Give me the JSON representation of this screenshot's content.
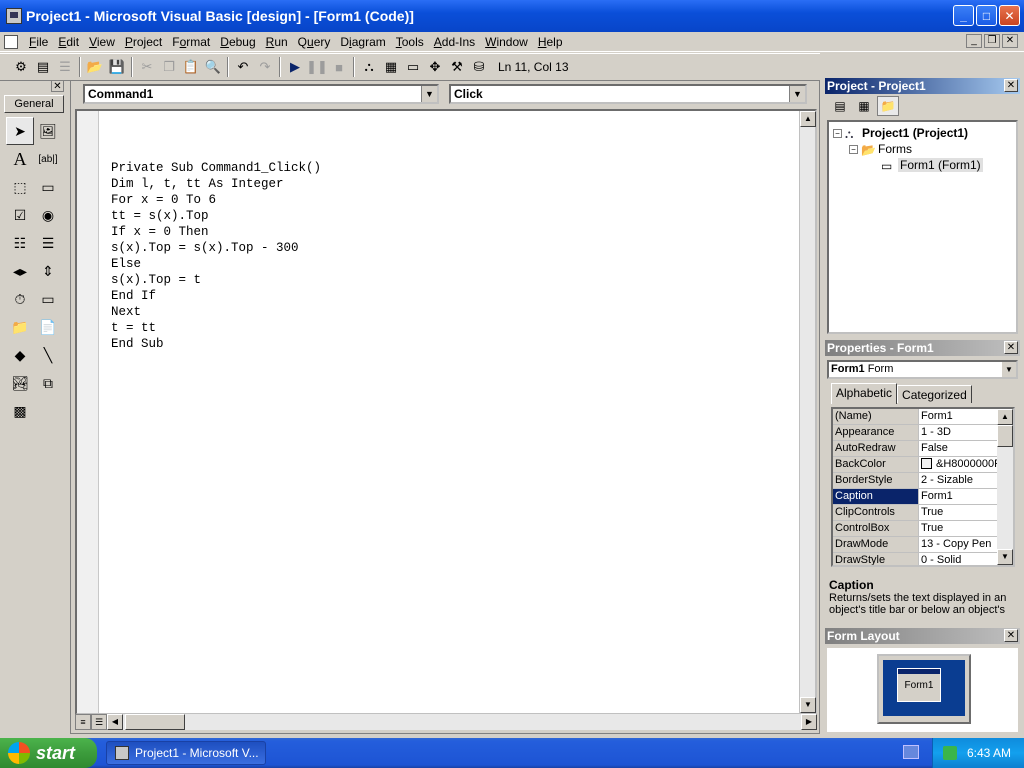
{
  "window": {
    "title": "Project1 - Microsoft Visual Basic [design] - [Form1 (Code)]"
  },
  "menu": [
    {
      "pre": "",
      "key": "F",
      "post": "ile"
    },
    {
      "pre": "",
      "key": "E",
      "post": "dit"
    },
    {
      "pre": "",
      "key": "V",
      "post": "iew"
    },
    {
      "pre": "",
      "key": "P",
      "post": "roject"
    },
    {
      "pre": "F",
      "key": "o",
      "post": "rmat"
    },
    {
      "pre": "",
      "key": "D",
      "post": "ebug"
    },
    {
      "pre": "",
      "key": "R",
      "post": "un"
    },
    {
      "pre": "Q",
      "key": "u",
      "post": "ery"
    },
    {
      "pre": "D",
      "key": "i",
      "post": "agram"
    },
    {
      "pre": "",
      "key": "T",
      "post": "ools"
    },
    {
      "pre": "",
      "key": "A",
      "post": "dd-Ins"
    },
    {
      "pre": "",
      "key": "W",
      "post": "indow"
    },
    {
      "pre": "",
      "key": "H",
      "post": "elp"
    }
  ],
  "toolbar": {
    "position": "Ln 11, Col 13"
  },
  "toolbox": {
    "tab": "General"
  },
  "code": {
    "object": "Command1",
    "procedure": "Click",
    "lines": [
      "Private Sub Command1_Click()",
      "Dim l, t, tt As Integer",
      "For x = 0 To 6",
      "tt = s(x).Top",
      "If x = 0 Then",
      "s(x).Top = s(x).Top - 300",
      "Else",
      "s(x).Top = t",
      "End If",
      "Next",
      "t = tt",
      "End Sub"
    ]
  },
  "project": {
    "title": "Project - Project1",
    "root": "Project1 (Project1)",
    "folder": "Forms",
    "item": "Form1 (Form1)"
  },
  "properties": {
    "title": "Properties - Form1",
    "object_name": "Form1",
    "object_type": "Form",
    "tabs": [
      "Alphabetic",
      "Categorized"
    ],
    "rows": [
      {
        "name": "(Name)",
        "value": "Form1"
      },
      {
        "name": "Appearance",
        "value": "1 - 3D"
      },
      {
        "name": "AutoRedraw",
        "value": "False"
      },
      {
        "name": "BackColor",
        "value": "&H8000000F"
      },
      {
        "name": "BorderStyle",
        "value": "2 - Sizable"
      },
      {
        "name": "Caption",
        "value": "Form1"
      },
      {
        "name": "ClipControls",
        "value": "True"
      },
      {
        "name": "ControlBox",
        "value": "True"
      },
      {
        "name": "DrawMode",
        "value": "13 - Copy Pen"
      },
      {
        "name": "DrawStyle",
        "value": "0 - Solid"
      }
    ],
    "desc_title": "Caption",
    "desc_text": "Returns/sets the text displayed in an object's title bar or below an object's"
  },
  "form_layout": {
    "title": "Form Layout",
    "form": "Form1"
  },
  "taskbar": {
    "start": "start",
    "task": "Project1 - Microsoft V...",
    "clock": "6:43 AM"
  }
}
